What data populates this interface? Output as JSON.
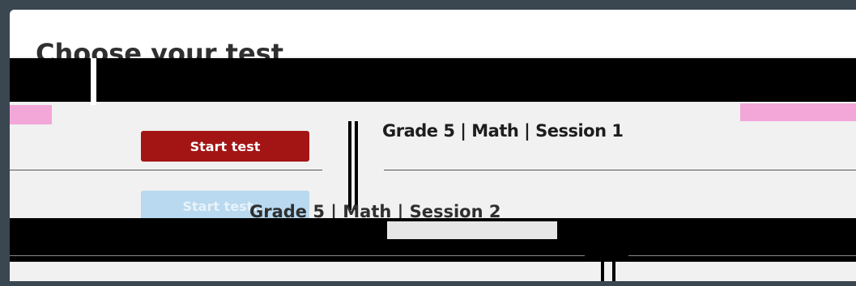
{
  "page": {
    "title": "Choose your test"
  },
  "tests": [
    {
      "button_label": "Start test",
      "label": "Grade 5 | Math | Session 1"
    },
    {
      "button_label": "Start test...",
      "label": "Grade 5 | Math | Session 2",
      "disabled": true
    }
  ],
  "colors": {
    "background": "#3a4650",
    "panel": "#f1f1f1",
    "start_button": "#a31515",
    "start_button_disabled": "#b8d9ef",
    "glitch_pink": "#f3a6d8"
  }
}
